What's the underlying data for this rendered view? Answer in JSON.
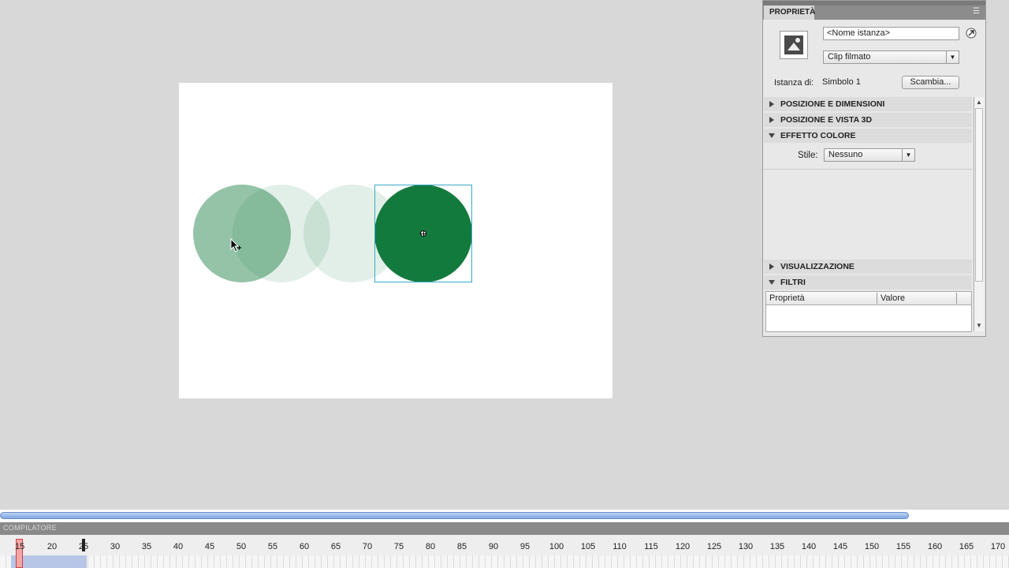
{
  "properties_panel": {
    "tab_label": "PROPRIETÀ",
    "instance_name_placeholder": "<Nome istanza>",
    "symbol_type": "Clip filmato",
    "instance_of_label": "Istanza di:",
    "instance_of_value": "Simbolo 1",
    "swap_button": "Scambia...",
    "sections": {
      "position_size": "POSIZIONE E DIMENSIONI",
      "position_3d": "POSIZIONE E VISTA 3D",
      "color_effect": "EFFETTO COLORE",
      "display": "VISUALIZZAZIONE",
      "filters": "FILTRI"
    },
    "style_label": "Stile:",
    "style_value": "Nessuno",
    "filters_table": {
      "col_property": "Proprietà",
      "col_value": "Valore"
    }
  },
  "timeline": {
    "panel_label": "COMPILATORE",
    "current_frame": "15",
    "ticks": [
      "20",
      "25",
      "30",
      "35",
      "40",
      "45",
      "50",
      "55",
      "60",
      "65",
      "70",
      "75",
      "80",
      "85",
      "90",
      "95",
      "100",
      "105",
      "110",
      "115",
      "120",
      "125",
      "130",
      "135",
      "140",
      "145",
      "150",
      "155",
      "160",
      "165",
      "170"
    ]
  },
  "colors": {
    "stage_bg": "#ffffff",
    "work_area": "#d8d8d8",
    "circle_solid": "#137a3e",
    "selection_box": "#3aa9c9"
  }
}
